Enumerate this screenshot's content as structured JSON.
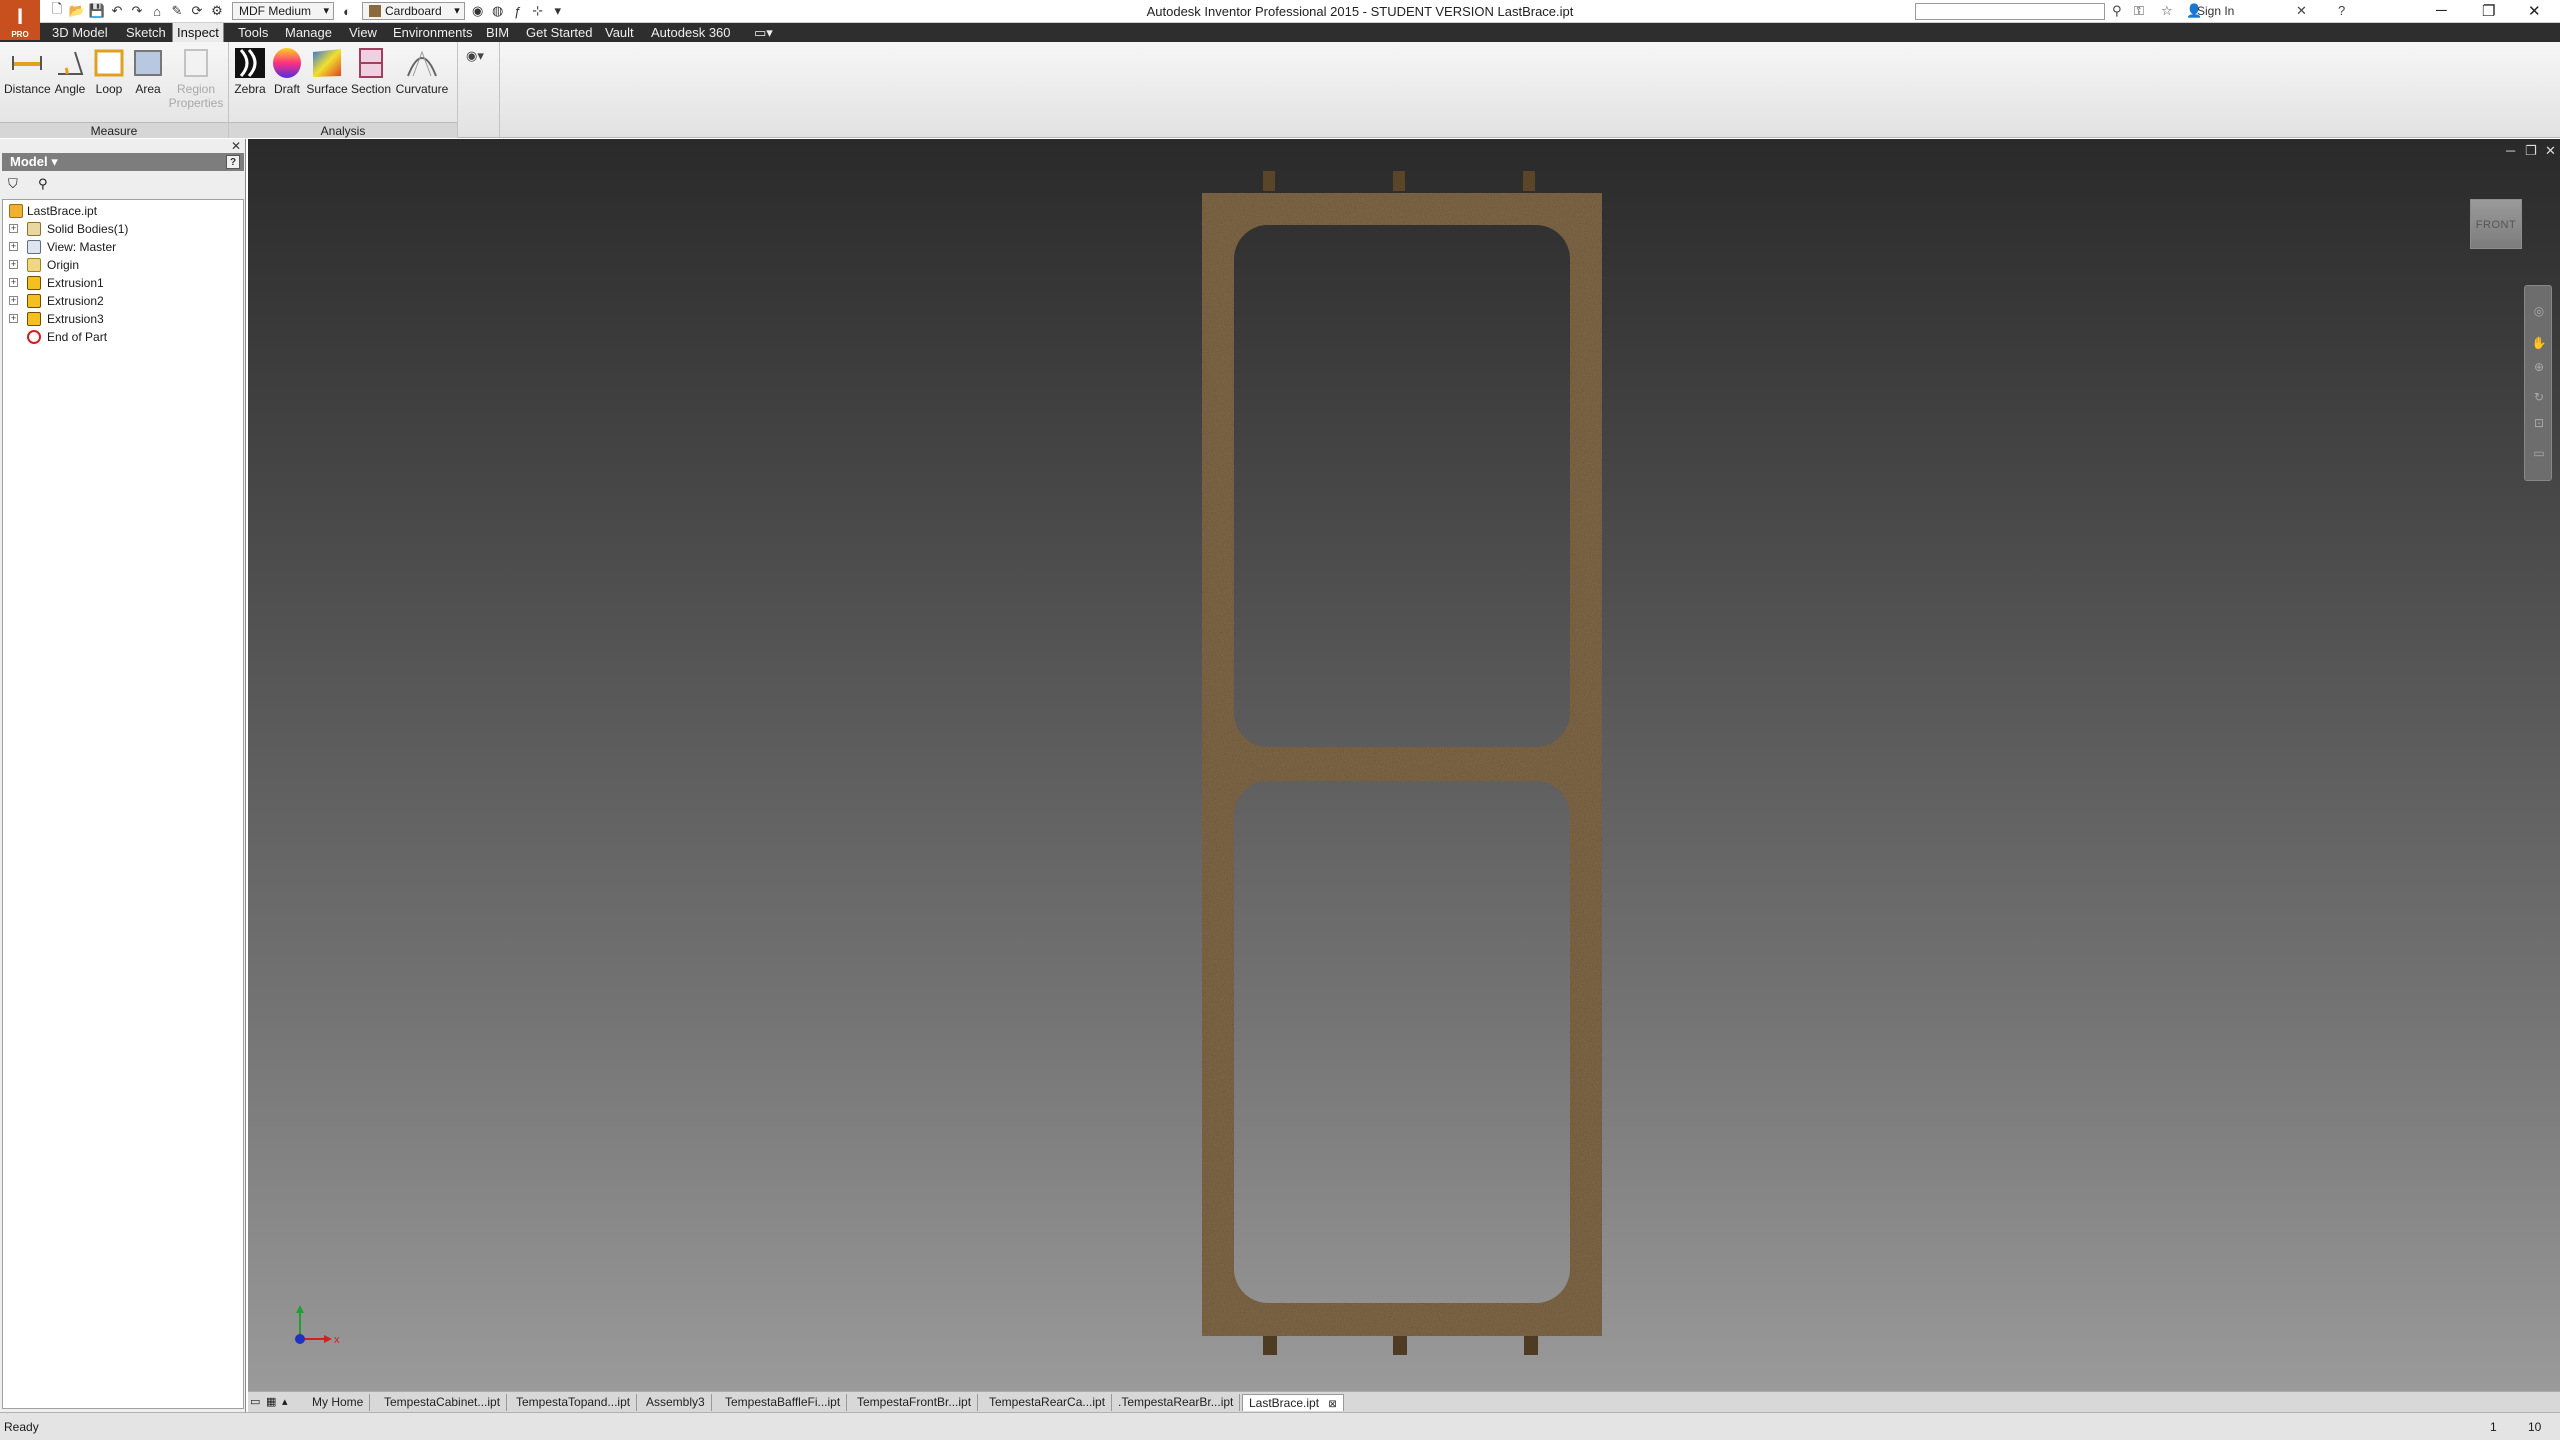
{
  "app": {
    "logo_text": "I",
    "logo_sub": "PRO",
    "window_title": "Autodesk Inventor Professional 2015 - STUDENT VERSION    LastBrace.ipt"
  },
  "quick_access": {
    "material": "MDF Medium",
    "appearance": "Cardboard"
  },
  "header_right": {
    "search_placeholder": "",
    "sign_in": "Sign In"
  },
  "ribbon_tabs": [
    "3D Model",
    "Sketch",
    "Inspect",
    "Tools",
    "Manage",
    "View",
    "Environments",
    "BIM",
    "Get Started",
    "Vault",
    "Autodesk 360"
  ],
  "active_tab": "Inspect",
  "ribbon": {
    "measure": {
      "label": "Measure",
      "buttons": [
        "Distance",
        "Angle",
        "Loop",
        "Area"
      ],
      "region_line1": "Region",
      "region_line2": "Properties"
    },
    "analysis": {
      "label": "Analysis",
      "buttons": [
        "Zebra",
        "Draft",
        "Surface",
        "Section",
        "Curvature"
      ]
    }
  },
  "browser": {
    "title": "Model",
    "help": "?",
    "nodes": [
      "LastBrace.ipt",
      "Solid Bodies(1)",
      "View: Master",
      "Origin",
      "Extrusion1",
      "Extrusion2",
      "Extrusion3",
      "End of Part"
    ]
  },
  "viewcube": {
    "face": "FRONT"
  },
  "triad": {
    "x": "x"
  },
  "doc_tabs": [
    "My Home",
    "TempestaCabinet...ipt",
    "TempestaTopand...ipt",
    "Assembly3",
    "TempestaBaffleFi...ipt",
    "TempestaFrontBr...ipt",
    "TempestaRearCa...ipt",
    ".TempestaRearBr...ipt",
    "LastBrace.ipt"
  ],
  "active_doc": "LastBrace.ipt",
  "status": {
    "text": "Ready",
    "n1": "1",
    "n2": "10"
  },
  "colors": {
    "accent": "#c8501e",
    "wood": "#6b5335",
    "ribbon_dark": "#2e2e2e",
    "viewport_top": "#2a2a2a",
    "viewport_bottom": "#9a9a9a"
  }
}
